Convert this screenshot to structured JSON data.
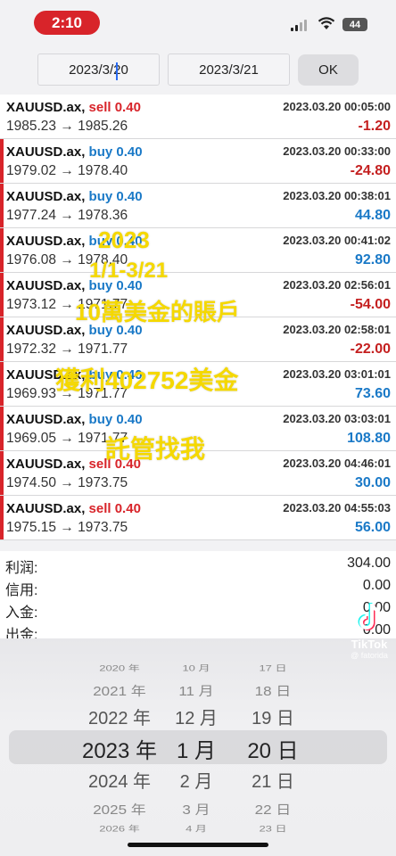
{
  "status": {
    "time": "2:10",
    "battery": "44"
  },
  "toolbar": {
    "date_from": "2023/3/20",
    "date_to": "2023/3/21",
    "ok_label": "OK"
  },
  "colors": {
    "sell": "#d8242a",
    "buy": "#1a79c7",
    "loss": "#c41f1f",
    "profit": "#1a79c7",
    "overlay": "#f5d800"
  },
  "trades": [
    {
      "symbol": "XAUUSD.ax,",
      "side": "sell 0.40",
      "time": "2023.03.20 00:05:00",
      "prices": "1985.23 → 1985.26",
      "pl": "-1.20",
      "marked": false
    },
    {
      "symbol": "XAUUSD.ax,",
      "side": "buy 0.40",
      "time": "2023.03.20 00:33:00",
      "prices": "1979.02 → 1978.40",
      "pl": "-24.80",
      "marked": true
    },
    {
      "symbol": "XAUUSD.ax,",
      "side": "buy 0.40",
      "time": "2023.03.20 00:38:01",
      "prices": "1977.24 → 1978.36",
      "pl": "44.80",
      "marked": true
    },
    {
      "symbol": "XAUUSD.ax,",
      "side": "buy 0.40",
      "time": "2023.03.20 00:41:02",
      "prices": "1976.08 → 1978.40",
      "pl": "92.80",
      "marked": true
    },
    {
      "symbol": "XAUUSD.ax,",
      "side": "buy 0.40",
      "time": "2023.03.20 02:56:01",
      "prices": "1973.12 → 1971.77",
      "pl": "-54.00",
      "marked": true
    },
    {
      "symbol": "XAUUSD.ax,",
      "side": "buy 0.40",
      "time": "2023.03.20 02:58:01",
      "prices": "1972.32 → 1971.77",
      "pl": "-22.00",
      "marked": true
    },
    {
      "symbol": "XAUUSD.ax,",
      "side": "buy 0.40",
      "time": "2023.03.20 03:01:01",
      "prices": "1969.93 → 1971.77",
      "pl": "73.60",
      "marked": true
    },
    {
      "symbol": "XAUUSD.ax,",
      "side": "buy 0.40",
      "time": "2023.03.20 03:03:01",
      "prices": "1969.05 → 1971.77",
      "pl": "108.80",
      "marked": true
    },
    {
      "symbol": "XAUUSD.ax,",
      "side": "sell 0.40",
      "time": "2023.03.20 04:46:01",
      "prices": "1974.50 → 1973.75",
      "pl": "30.00",
      "marked": true
    },
    {
      "symbol": "XAUUSD.ax,",
      "side": "sell 0.40",
      "time": "2023.03.20 04:55:03",
      "prices": "1975.15 → 1973.75",
      "pl": "56.00",
      "marked": true
    }
  ],
  "summary": [
    {
      "label": "利润:",
      "value": "304.00"
    },
    {
      "label": "信用:",
      "value": "0.00"
    },
    {
      "label": "入金:",
      "value": "0.00"
    },
    {
      "label": "出金:",
      "value": "0.00"
    }
  ],
  "overlay_text": [
    "2023",
    "1/1-3/21",
    "10萬美金的賬戶",
    "獲利402752美金",
    "託管找我"
  ],
  "picker": {
    "years": [
      "2020 年",
      "2021 年",
      "2022 年",
      "2023 年",
      "2024 年",
      "2025 年",
      "2026 年"
    ],
    "months": [
      "10 月",
      "11 月",
      "12 月",
      "1 月",
      "2 月",
      "3 月",
      "4 月"
    ],
    "days": [
      "17 日",
      "18 日",
      "19 日",
      "20 日",
      "21 日",
      "22 日",
      "23 日"
    ],
    "selected_index": 3
  },
  "watermark": {
    "brand": "TikTok",
    "handle": "@ fatorida"
  }
}
